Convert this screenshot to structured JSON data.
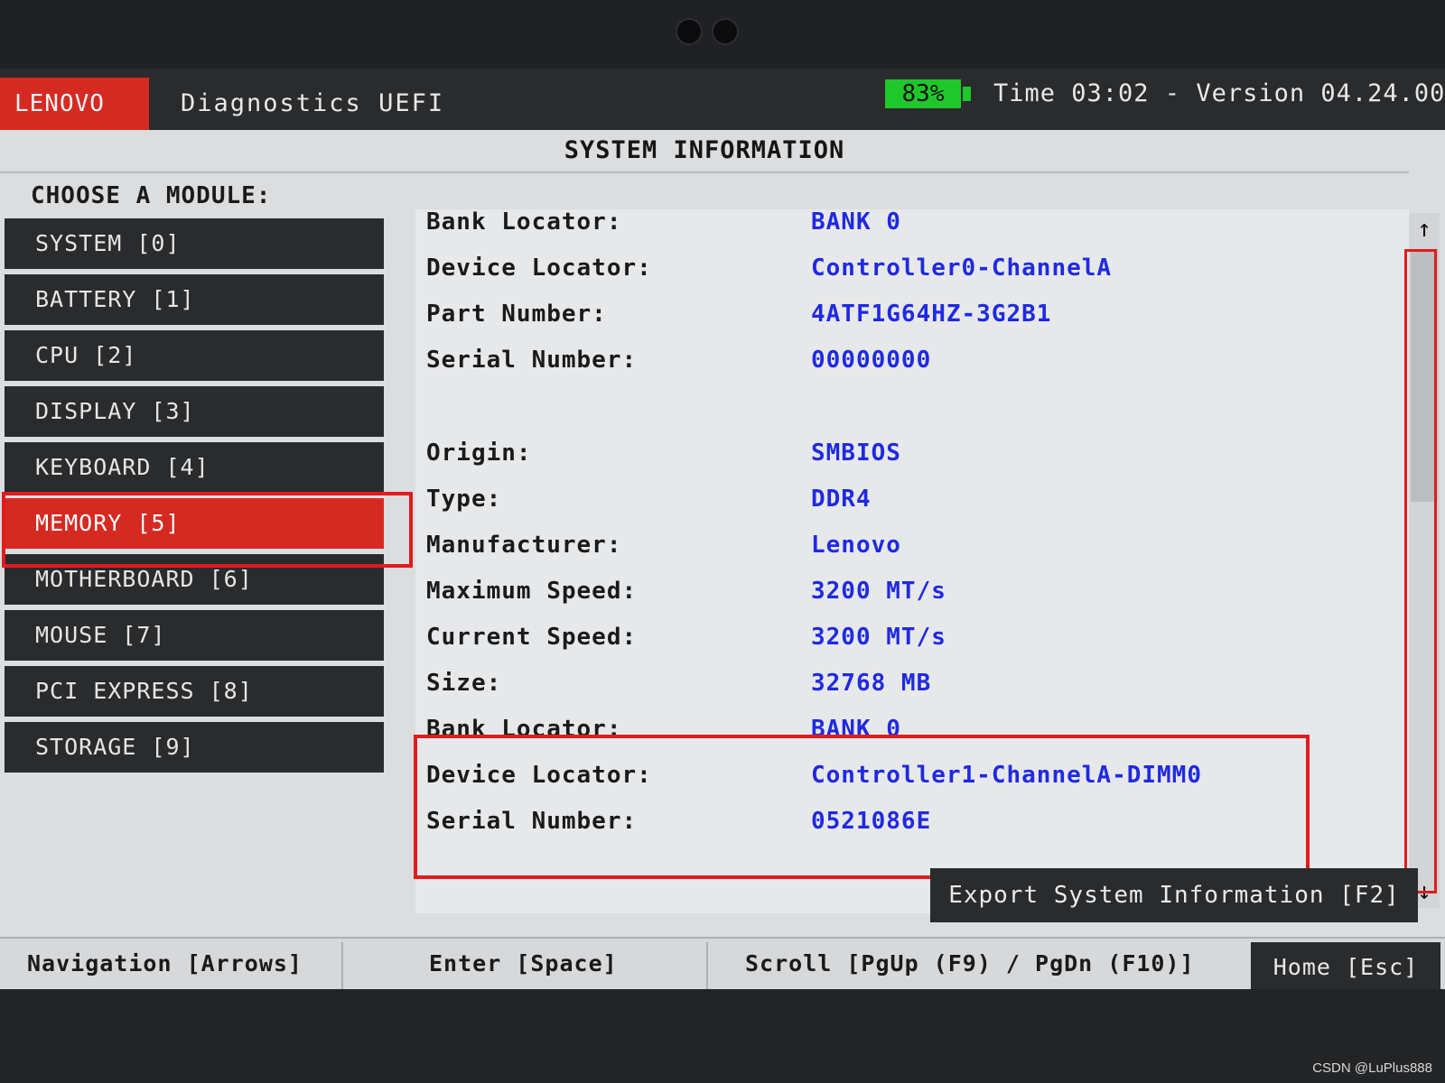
{
  "header": {
    "brand": "LENOVO",
    "title": "Diagnostics UEFI",
    "battery": "83%",
    "status": "Time 03:02 - Version 04.24.00"
  },
  "page_title": "SYSTEM INFORMATION",
  "sidebar": {
    "heading": "CHOOSE A MODULE:",
    "items": [
      {
        "label": "SYSTEM [0]"
      },
      {
        "label": "BATTERY [1]"
      },
      {
        "label": "CPU [2]"
      },
      {
        "label": "DISPLAY [3]"
      },
      {
        "label": "KEYBOARD [4]"
      },
      {
        "label": "MEMORY [5]"
      },
      {
        "label": "MOTHERBOARD [6]"
      },
      {
        "label": "MOUSE [7]"
      },
      {
        "label": "PCI EXPRESS [8]"
      },
      {
        "label": "STORAGE [9]"
      }
    ],
    "selected": "MEMORY [5]"
  },
  "details": {
    "rows": [
      {
        "label": "Bank Locator:",
        "value": "BANK 0"
      },
      {
        "label": "Device Locator:",
        "value": "Controller0-ChannelA"
      },
      {
        "label": "Part Number:",
        "value": "4ATF1G64HZ-3G2B1"
      },
      {
        "label": "Serial Number:",
        "value": "00000000"
      },
      {
        "label": "Origin:",
        "value": "SMBIOS"
      },
      {
        "label": "Type:",
        "value": "DDR4"
      },
      {
        "label": "Manufacturer:",
        "value": "Lenovo"
      },
      {
        "label": "Maximum Speed:",
        "value": "3200 MT/s"
      },
      {
        "label": "Current Speed:",
        "value": "3200 MT/s"
      },
      {
        "label": "Size:",
        "value": "32768 MB"
      },
      {
        "label": "Bank Locator:",
        "value": "BANK 0"
      },
      {
        "label": "Device Locator:",
        "value": "Controller1-ChannelA-DIMM0"
      },
      {
        "label": "Serial Number:",
        "value": "0521086E"
      }
    ]
  },
  "scrollbar": {
    "up_icon": "↑",
    "down_icon": "↓"
  },
  "actions": {
    "export_label": "Export System Information [F2]"
  },
  "footer": {
    "navigation": "Navigation [Arrows]",
    "enter": "Enter [Space]",
    "scroll": "Scroll [PgUp (F9) / PgDn (F10)]",
    "home": "Home [Esc]"
  },
  "watermark": "CSDN @LuPlus888",
  "colors": {
    "accent": "#d52a22",
    "value_text": "#1f2ae0",
    "battery": "#1fc72a",
    "highlight": "#e01c1c"
  }
}
